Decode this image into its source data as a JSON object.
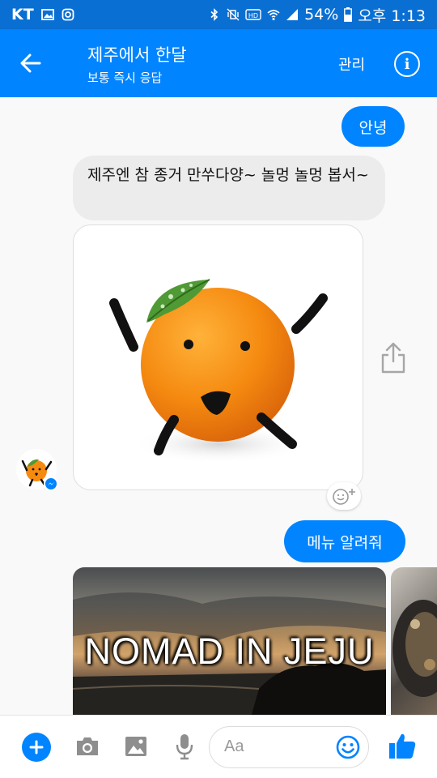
{
  "status_bar": {
    "carrier": "KT",
    "battery": "54%",
    "time": "오후 1:13"
  },
  "header": {
    "title": "제주에서 한달",
    "subtitle": "보통 즉시 응답",
    "manage_label": "관리"
  },
  "messages": {
    "greeting": "안녕",
    "bot_reply": "제주엔 참 종거 만쑤다양~ 놀멍 놀멍 봅서~",
    "menu_request": "메뉴 알려줘"
  },
  "carousel": {
    "card1_title": "NOMAD IN JEJU"
  },
  "composer": {
    "placeholder": "Aa"
  },
  "colors": {
    "brand": "#0084ff",
    "status_bar": "#0a6fd3"
  }
}
